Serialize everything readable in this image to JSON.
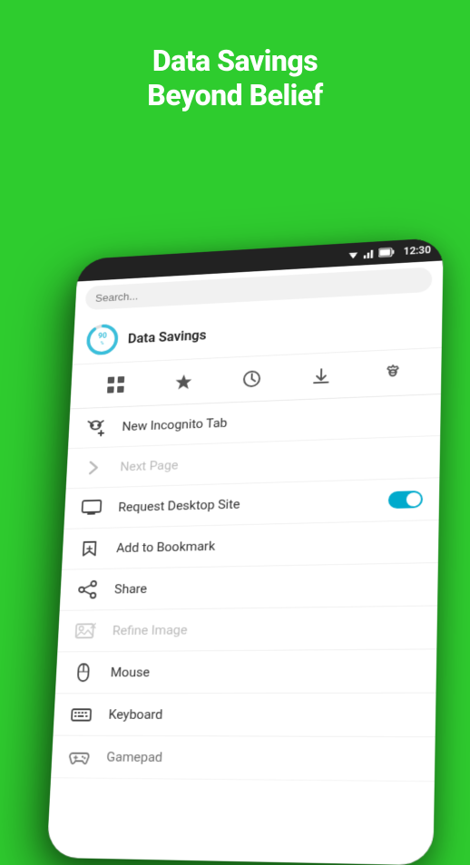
{
  "hero": {
    "line1": "Data Savings",
    "line2": "Beyond Belief"
  },
  "status_bar": {
    "time": "12:30"
  },
  "search": {
    "placeholder": "Search..."
  },
  "data_savings": {
    "percent": "90",
    "percent_symbol": "%",
    "label": "Data Savings"
  },
  "toolbar": {
    "icons": [
      {
        "name": "grid-icon",
        "symbol": "⊞"
      },
      {
        "name": "star-icon",
        "symbol": "★"
      },
      {
        "name": "history-icon",
        "symbol": "◷"
      },
      {
        "name": "download-icon",
        "symbol": "⬇"
      },
      {
        "name": "settings-icon",
        "symbol": "⚙"
      }
    ]
  },
  "menu_items": [
    {
      "id": "new-incognito-tab",
      "icon_name": "incognito-icon",
      "label": "New Incognito Tab",
      "disabled": false,
      "has_toggle": false
    },
    {
      "id": "next-page",
      "icon_name": "chevron-right-icon",
      "label": "Next Page",
      "disabled": true,
      "has_toggle": false
    },
    {
      "id": "request-desktop-site",
      "icon_name": "desktop-icon",
      "label": "Request Desktop Site",
      "disabled": false,
      "has_toggle": true
    },
    {
      "id": "add-to-bookmark",
      "icon_name": "bookmark-icon",
      "label": "Add to Bookmark",
      "disabled": false,
      "has_toggle": false
    },
    {
      "id": "share",
      "icon_name": "share-icon",
      "label": "Share",
      "disabled": false,
      "has_toggle": false
    },
    {
      "id": "refine-image",
      "icon_name": "refine-image-icon",
      "label": "Refine Image",
      "disabled": true,
      "has_toggle": false
    },
    {
      "id": "mouse",
      "icon_name": "mouse-icon",
      "label": "Mouse",
      "disabled": false,
      "has_toggle": false
    },
    {
      "id": "keyboard",
      "icon_name": "keyboard-icon",
      "label": "Keyboard",
      "disabled": false,
      "has_toggle": false
    },
    {
      "id": "gamepad",
      "icon_name": "gamepad-icon",
      "label": "Gamepad",
      "disabled": false,
      "has_toggle": false
    }
  ],
  "colors": {
    "green": "#2ecc2e",
    "white": "#ffffff",
    "toggle_on": "#00aacc",
    "disabled_text": "#bbb",
    "icon_color": "#555",
    "donut_color": "#3bbfdb"
  }
}
